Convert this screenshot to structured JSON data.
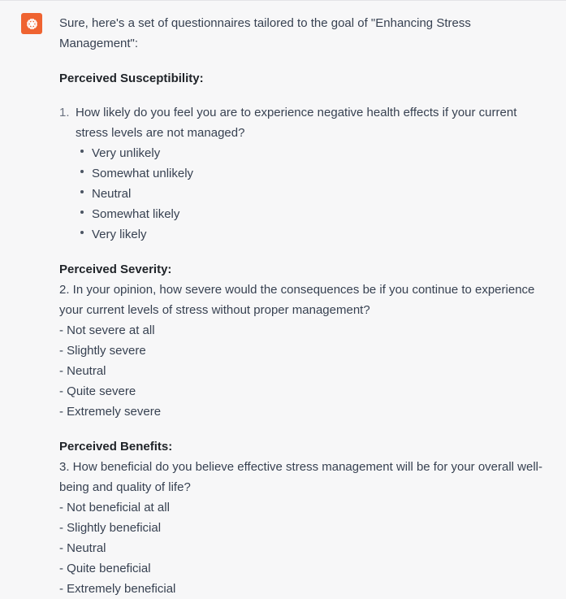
{
  "assistant": {
    "avatar_icon": "openai-logo-icon",
    "accent_color": "#ef6331"
  },
  "message": {
    "intro": "Sure, here's a set of questionnaires tailored to the goal of \"Enhancing Stress Management\":",
    "sections": [
      {
        "heading": "Perceived Susceptibility:",
        "question_number": "1.",
        "question": "How likely do you feel you are to experience negative health effects if your current stress levels are not managed?",
        "options": [
          "Very unlikely",
          "Somewhat unlikely",
          "Neutral",
          "Somewhat likely",
          "Very likely"
        ]
      },
      {
        "heading": "Perceived Severity:",
        "question": "2. In your opinion, how severe would the consequences be if you continue to experience your current levels of stress without proper management?",
        "options": [
          "- Not severe at all",
          "- Slightly severe",
          "- Neutral",
          "- Quite severe",
          "- Extremely severe"
        ]
      },
      {
        "heading": "Perceived Benefits:",
        "question": "3. How beneficial do you believe effective stress management will be for your overall well-being and quality of life?",
        "options": [
          "- Not beneficial at all",
          "- Slightly beneficial",
          "- Neutral",
          "- Quite beneficial",
          "- Extremely beneficial"
        ]
      }
    ]
  }
}
